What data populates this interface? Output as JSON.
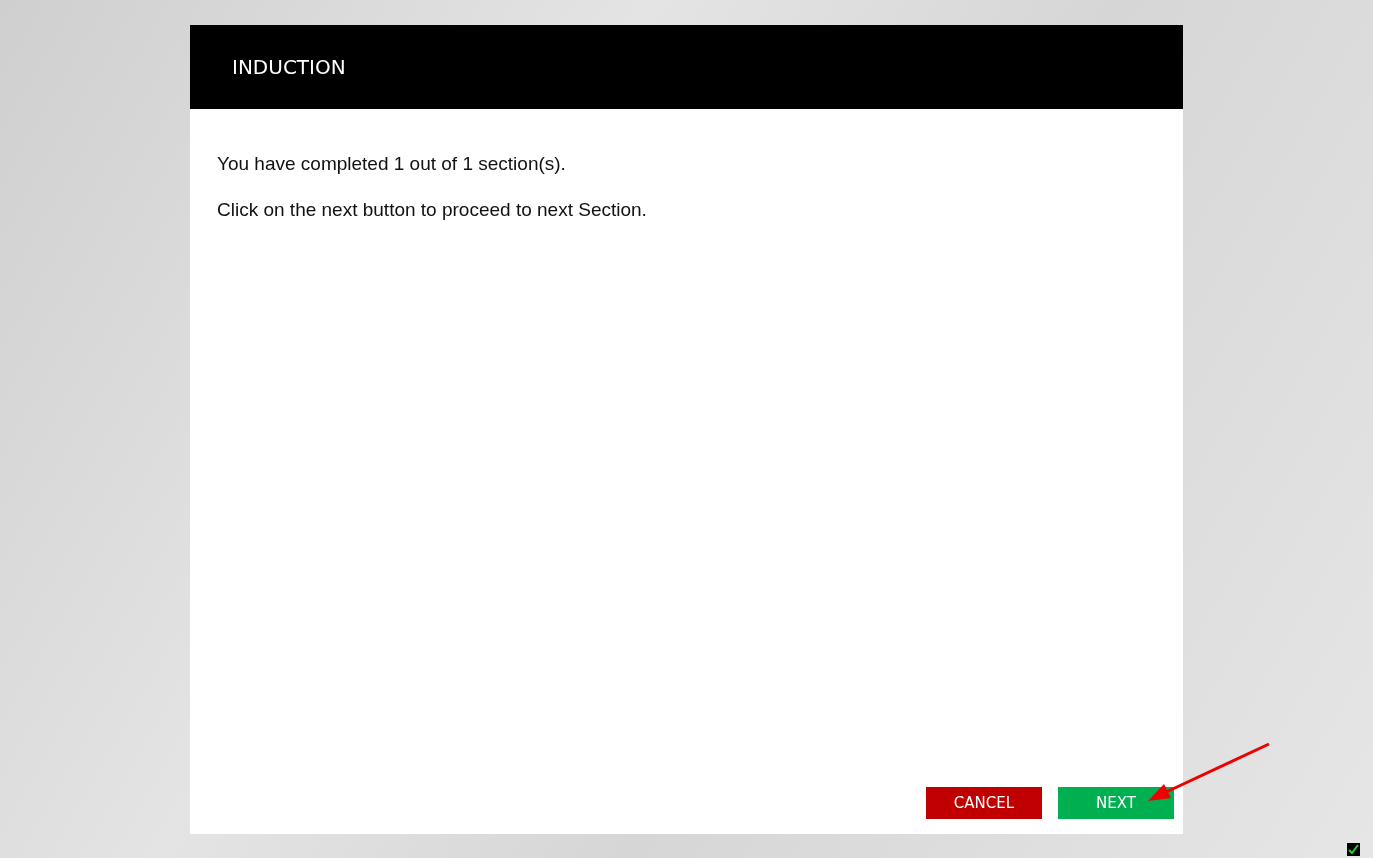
{
  "dialog": {
    "title": "INDUCTION",
    "messages": [
      "You have completed 1 out of 1 section(s).",
      "Click on the next button to proceed to next Section."
    ],
    "buttons": [
      {
        "label": "CANCEL",
        "kind": "cancel"
      },
      {
        "label": "NEXT",
        "kind": "next"
      }
    ]
  }
}
